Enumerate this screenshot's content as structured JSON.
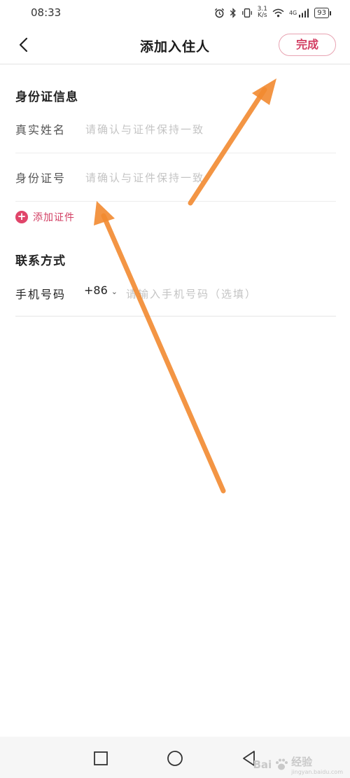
{
  "status_bar": {
    "time": "08:33",
    "net_speed_value": "3.1",
    "net_speed_unit": "K/s",
    "network_type": "4G",
    "battery": "93",
    "icons": [
      "alarm-icon",
      "bluetooth-icon",
      "vibrate-icon",
      "wifi-icon",
      "signal-icon",
      "battery-icon"
    ]
  },
  "header": {
    "back_icon": "chevron-left-icon",
    "title": "添加入住人",
    "done_label": "完成"
  },
  "id_section": {
    "title": "身份证信息",
    "name_label": "真实姓名",
    "name_placeholder": "请确认与证件保持一致",
    "name_value": "",
    "id_label": "身份证号",
    "id_placeholder": "请确认与证件保持一致",
    "id_value": "",
    "add_cert_label": "添加证件"
  },
  "contact_section": {
    "title": "联系方式",
    "phone_label": "手机号码",
    "country_code": "+86",
    "phone_placeholder": "请输入手机号码（选填）",
    "phone_value": ""
  },
  "system_nav": {
    "icons": [
      "recent-apps-icon",
      "home-icon",
      "back-icon"
    ]
  },
  "watermark": {
    "brand": "Bai",
    "suffix": "经验",
    "url": "jingyan.baidu.com"
  },
  "colors": {
    "accent": "#d23f63",
    "annotation_arrow": "#f28a30"
  }
}
